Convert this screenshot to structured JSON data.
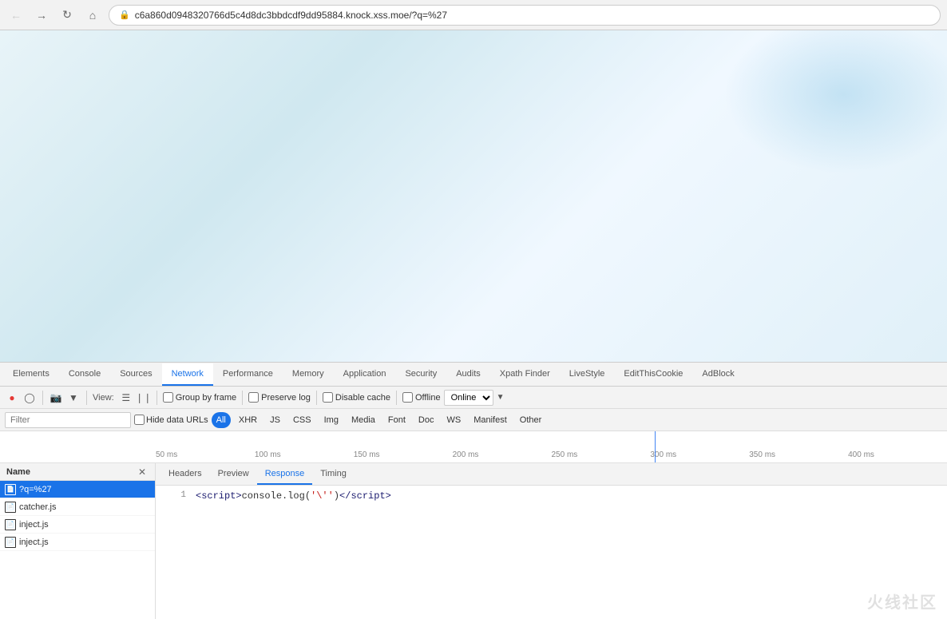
{
  "browser": {
    "url": "c6a860d0948320766d5c4d8dc3bbdcdf9dd95884.knock.xss.moe/?q=%27",
    "back_disabled": false,
    "forward_disabled": true
  },
  "devtools": {
    "tabs": [
      {
        "id": "elements",
        "label": "Elements",
        "active": false
      },
      {
        "id": "console",
        "label": "Console",
        "active": false
      },
      {
        "id": "sources",
        "label": "Sources",
        "active": false
      },
      {
        "id": "network",
        "label": "Network",
        "active": true
      },
      {
        "id": "performance",
        "label": "Performance",
        "active": false
      },
      {
        "id": "memory",
        "label": "Memory",
        "active": false
      },
      {
        "id": "application",
        "label": "Application",
        "active": false
      },
      {
        "id": "security",
        "label": "Security",
        "active": false
      },
      {
        "id": "audits",
        "label": "Audits",
        "active": false
      },
      {
        "id": "xpath-finder",
        "label": "Xpath Finder",
        "active": false
      },
      {
        "id": "livestyle",
        "label": "LiveStyle",
        "active": false
      },
      {
        "id": "editthiscookie",
        "label": "EditThisCookie",
        "active": false
      },
      {
        "id": "adblock",
        "label": "AdBlock",
        "active": false
      }
    ],
    "toolbar": {
      "view_label": "View:",
      "group_by_frame_label": "Group by frame",
      "preserve_log_label": "Preserve log",
      "disable_cache_label": "Disable cache",
      "offline_label": "Offline",
      "online_label": "Online"
    },
    "filter": {
      "placeholder": "Filter",
      "hide_data_urls_label": "Hide data URLs",
      "types": [
        "All",
        "XHR",
        "JS",
        "CSS",
        "Img",
        "Media",
        "Font",
        "Doc",
        "WS",
        "Manifest",
        "Other"
      ]
    },
    "timeline": {
      "labels": [
        "50 ms",
        "100 ms",
        "150 ms",
        "200 ms",
        "250 ms",
        "300 ms",
        "350 ms",
        "400 ms"
      ]
    },
    "file_list": {
      "header": "Name",
      "files": [
        {
          "name": "?q=%27",
          "selected": true
        },
        {
          "name": "catcher.js",
          "selected": false
        },
        {
          "name": "inject.js",
          "selected": false
        },
        {
          "name": "inject.js",
          "selected": false
        }
      ]
    },
    "response_panel": {
      "tabs": [
        {
          "id": "headers",
          "label": "Headers",
          "active": false
        },
        {
          "id": "preview",
          "label": "Preview",
          "active": false
        },
        {
          "id": "response",
          "label": "Response",
          "active": true
        },
        {
          "id": "timing",
          "label": "Timing",
          "active": false
        }
      ],
      "code_lines": [
        {
          "line_number": "1",
          "content": "<script>console.log('\\'')<\\/script>"
        }
      ]
    }
  },
  "watermark": "火线社区"
}
